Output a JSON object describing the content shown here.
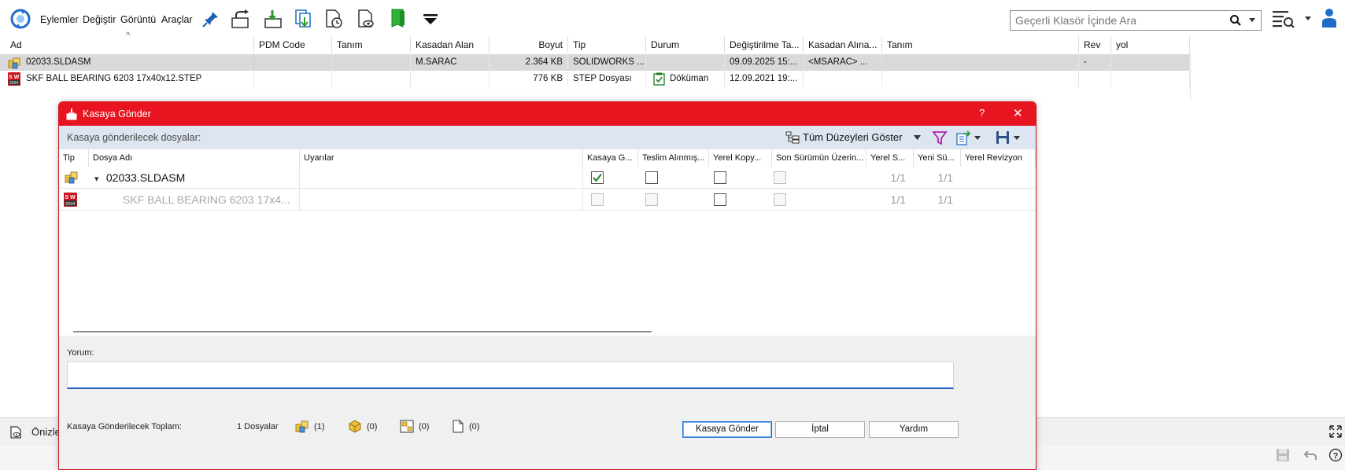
{
  "toolbar": {
    "menus": [
      "Eylemler",
      "Değiştir",
      "Görüntü",
      "Araçlar"
    ],
    "search_placeholder": "Geçerli Klasör İçinde Ara",
    "icons": [
      "refresh-icon",
      "pin-icon",
      "check-out-icon",
      "check-in-icon",
      "get-latest-icon",
      "get-version-icon",
      "preview-file-icon",
      "green-document-icon",
      "dropdown-triangle-icon",
      "search-icon",
      "search-options-icon",
      "user-icon"
    ]
  },
  "file_list": {
    "sort_indicator": "^",
    "columns": [
      "Ad",
      "PDM Code",
      "Tanım",
      "Kasadan Alan",
      "Boyut",
      "Tip",
      "Durum",
      "Değiştirilme Ta...",
      "Kasadan Alına...",
      "Tanım",
      "Rev",
      "yol"
    ],
    "rows": [
      {
        "name": "02033.SLDASM",
        "pdm_code": "",
        "description": "",
        "checked_out_by": "M.SARAC",
        "size": "2.364 KB",
        "type": "SOLIDWORKS ...",
        "state": "",
        "modified": "09.09.2025 15:...",
        "checked_out_in": "<MSARAC> ...",
        "description2": "",
        "rev": "-",
        "path": "",
        "selected": true
      },
      {
        "name": "SKF BALL BEARING 6203 17x40x12.STEP",
        "pdm_code": "",
        "description": "",
        "checked_out_by": "",
        "size": "776 KB",
        "type": "STEP Dosyası",
        "state": "Döküman",
        "modified": "12.09.2021 19:...",
        "checked_out_in": "",
        "description2": "",
        "rev": "",
        "path": "",
        "selected": false
      }
    ]
  },
  "preview_bar": {
    "label": "Önizle",
    "icons": [
      "preview-icon",
      "expand-icon",
      "save-icon",
      "undo-icon",
      "help-icon"
    ]
  },
  "dialog": {
    "title": "Kasaya Gönder",
    "help_glyph": "?",
    "close_glyph": "✕",
    "subbar_label": "Kasaya gönderilecek dosyalar:",
    "show_levels_label": "Tüm Düzeyleri Göster",
    "grid_columns": [
      "Tip",
      "Dosya Adı",
      "Uyarılar",
      "Kasaya G...",
      "Teslim Alınmış...",
      "Yerel Kopy...",
      "Son Sürümün Üzerin...",
      "Yerel S...",
      "Yeni Sü...",
      "Yerel Revizyon"
    ],
    "grid_rows": [
      {
        "expand_glyph": "▾",
        "file_name": "02033.SLDASM",
        "warnings": "",
        "check_in": true,
        "keep_checked_out": false,
        "remove_local_copy": false,
        "overwrite_latest": false,
        "local_version": "1/1",
        "new_version": "1/1",
        "local_revision": "",
        "enabled": true
      },
      {
        "expand_glyph": "",
        "file_name": "SKF BALL BEARING 6203 17x4...",
        "warnings": "",
        "check_in": false,
        "keep_checked_out": false,
        "remove_local_copy": false,
        "overwrite_latest": false,
        "local_version": "1/1",
        "new_version": "1/1",
        "local_revision": "",
        "enabled": false
      }
    ],
    "comment_label": "Yorum:",
    "comment_value": "",
    "total_label": "Kasaya Gönderilecek Toplam:",
    "file_count": "1 Dosyalar",
    "stats": [
      {
        "icon": "assembly-icon",
        "value": "(1)"
      },
      {
        "icon": "part-icon",
        "value": "(0)"
      },
      {
        "icon": "drawing-icon",
        "value": "(0)"
      },
      {
        "icon": "document-icon",
        "value": "(0)"
      }
    ],
    "buttons": {
      "submit": "Kasaya Gönder",
      "cancel": "İptal",
      "help": "Yardım"
    },
    "colors": {
      "title_bar": "#e8141f",
      "subbar": "#dde5f0",
      "check_green": "#2e8b2e",
      "focus_blue": "#1f5fbf"
    }
  }
}
